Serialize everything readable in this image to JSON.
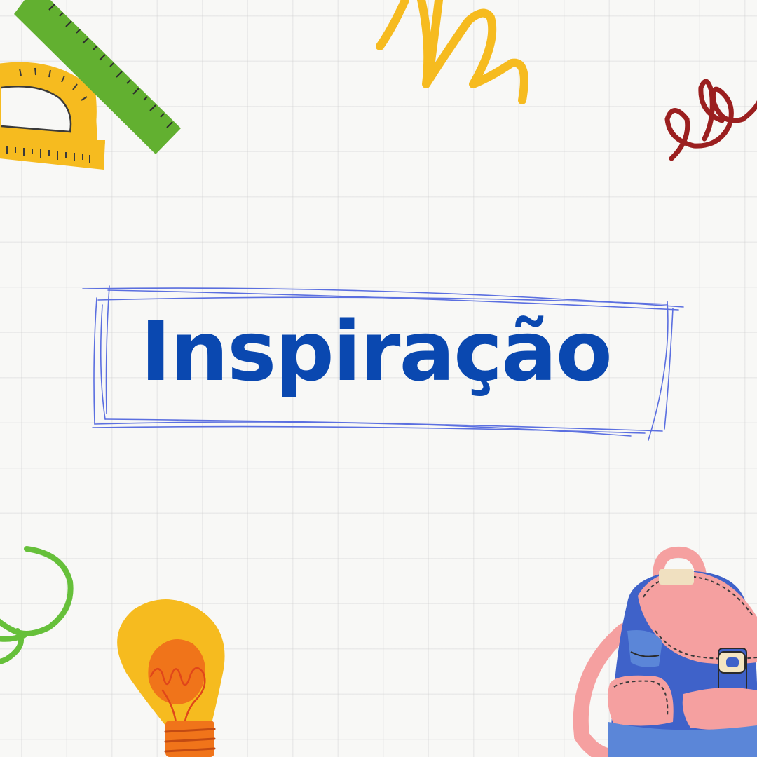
{
  "title": {
    "text": "Inspiração",
    "color": "#0a48b0"
  },
  "colors": {
    "background": "#f8f8f6",
    "frame_stroke": "#5b6fe0",
    "ruler": "#62b030",
    "protractor": "#f6bb1f",
    "squiggle_yellow": "#f6bb1f",
    "squiggle_red": "#9b1f1f",
    "squiggle_green": "#66c03a",
    "bulb_yellow": "#f6bb1f",
    "bulb_orange": "#f0741a",
    "backpack_blue": "#3f62c9",
    "backpack_pink": "#f5a0a0"
  },
  "decorations": [
    "ruler-icon",
    "protractor-icon",
    "yellow-squiggle",
    "red-squiggle",
    "green-squiggle",
    "lightbulb-icon",
    "backpack-icon"
  ]
}
